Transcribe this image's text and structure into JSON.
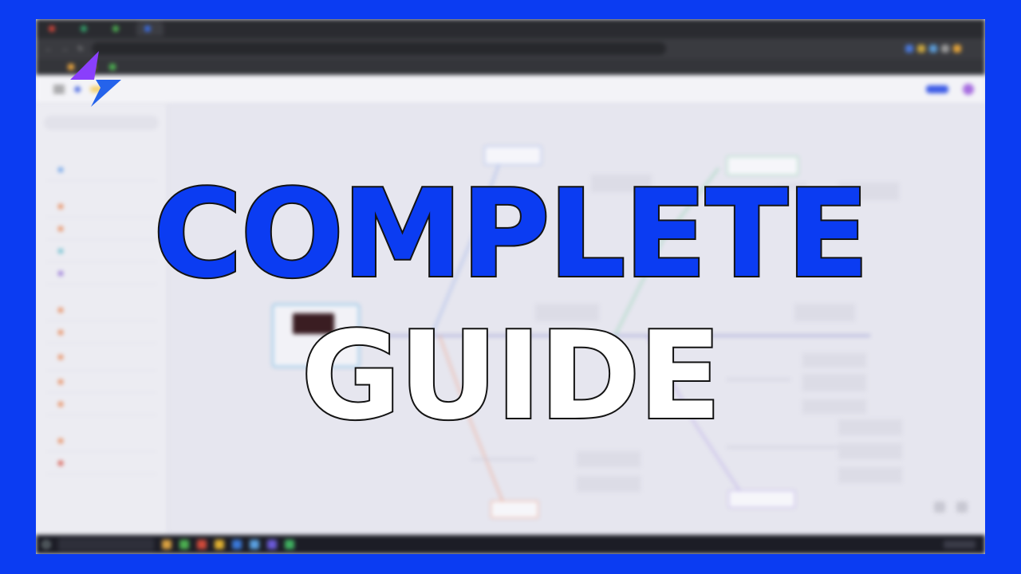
{
  "overlay": {
    "title_line1": "COMPLETE",
    "title_line2": "GUIDE",
    "title_line1_color": "#0b3cf2",
    "title_line2_color": "#ffffff",
    "frame_color": "#0b3cf2"
  },
  "brand_logo": {
    "icon": "lightning-bolt-icon",
    "colors": [
      "#8a3ffc",
      "#2563eb"
    ]
  },
  "browser": {
    "tabs": [
      {
        "label": "",
        "color": "#d0453a"
      },
      {
        "label": "",
        "color": "#33a06a"
      },
      {
        "label": "",
        "color": "#4caf50"
      },
      {
        "label": "",
        "color": "#3b6ee6"
      }
    ],
    "url": "",
    "bookmarks": [
      "",
      "",
      ""
    ]
  },
  "app": {
    "workspace_badge": "",
    "header": {
      "items": [
        "",
        "",
        ""
      ],
      "share": ""
    },
    "sidebar": {
      "search": "",
      "heading": "",
      "sections": [
        {
          "title": "",
          "items": [
            {
              "color": "#6aa0e8"
            }
          ]
        },
        {
          "title": "",
          "items": [
            {
              "color": "#e88a5a"
            },
            {
              "color": "#e88a5a"
            },
            {
              "color": "#6fc0d0"
            },
            {
              "color": "#9a7ad8"
            }
          ]
        },
        {
          "title": "",
          "items": [
            {
              "color": "#e88a5a"
            },
            {
              "color": "#e88a5a"
            },
            {
              "color": "#e88a5a"
            },
            {
              "color": "#e88a5a"
            },
            {
              "color": "#e88a5a"
            }
          ]
        },
        {
          "title": "",
          "items": [
            {
              "color": "#e88a5a"
            },
            {
              "color": "#d8584a"
            }
          ]
        }
      ]
    },
    "zoom": ""
  }
}
